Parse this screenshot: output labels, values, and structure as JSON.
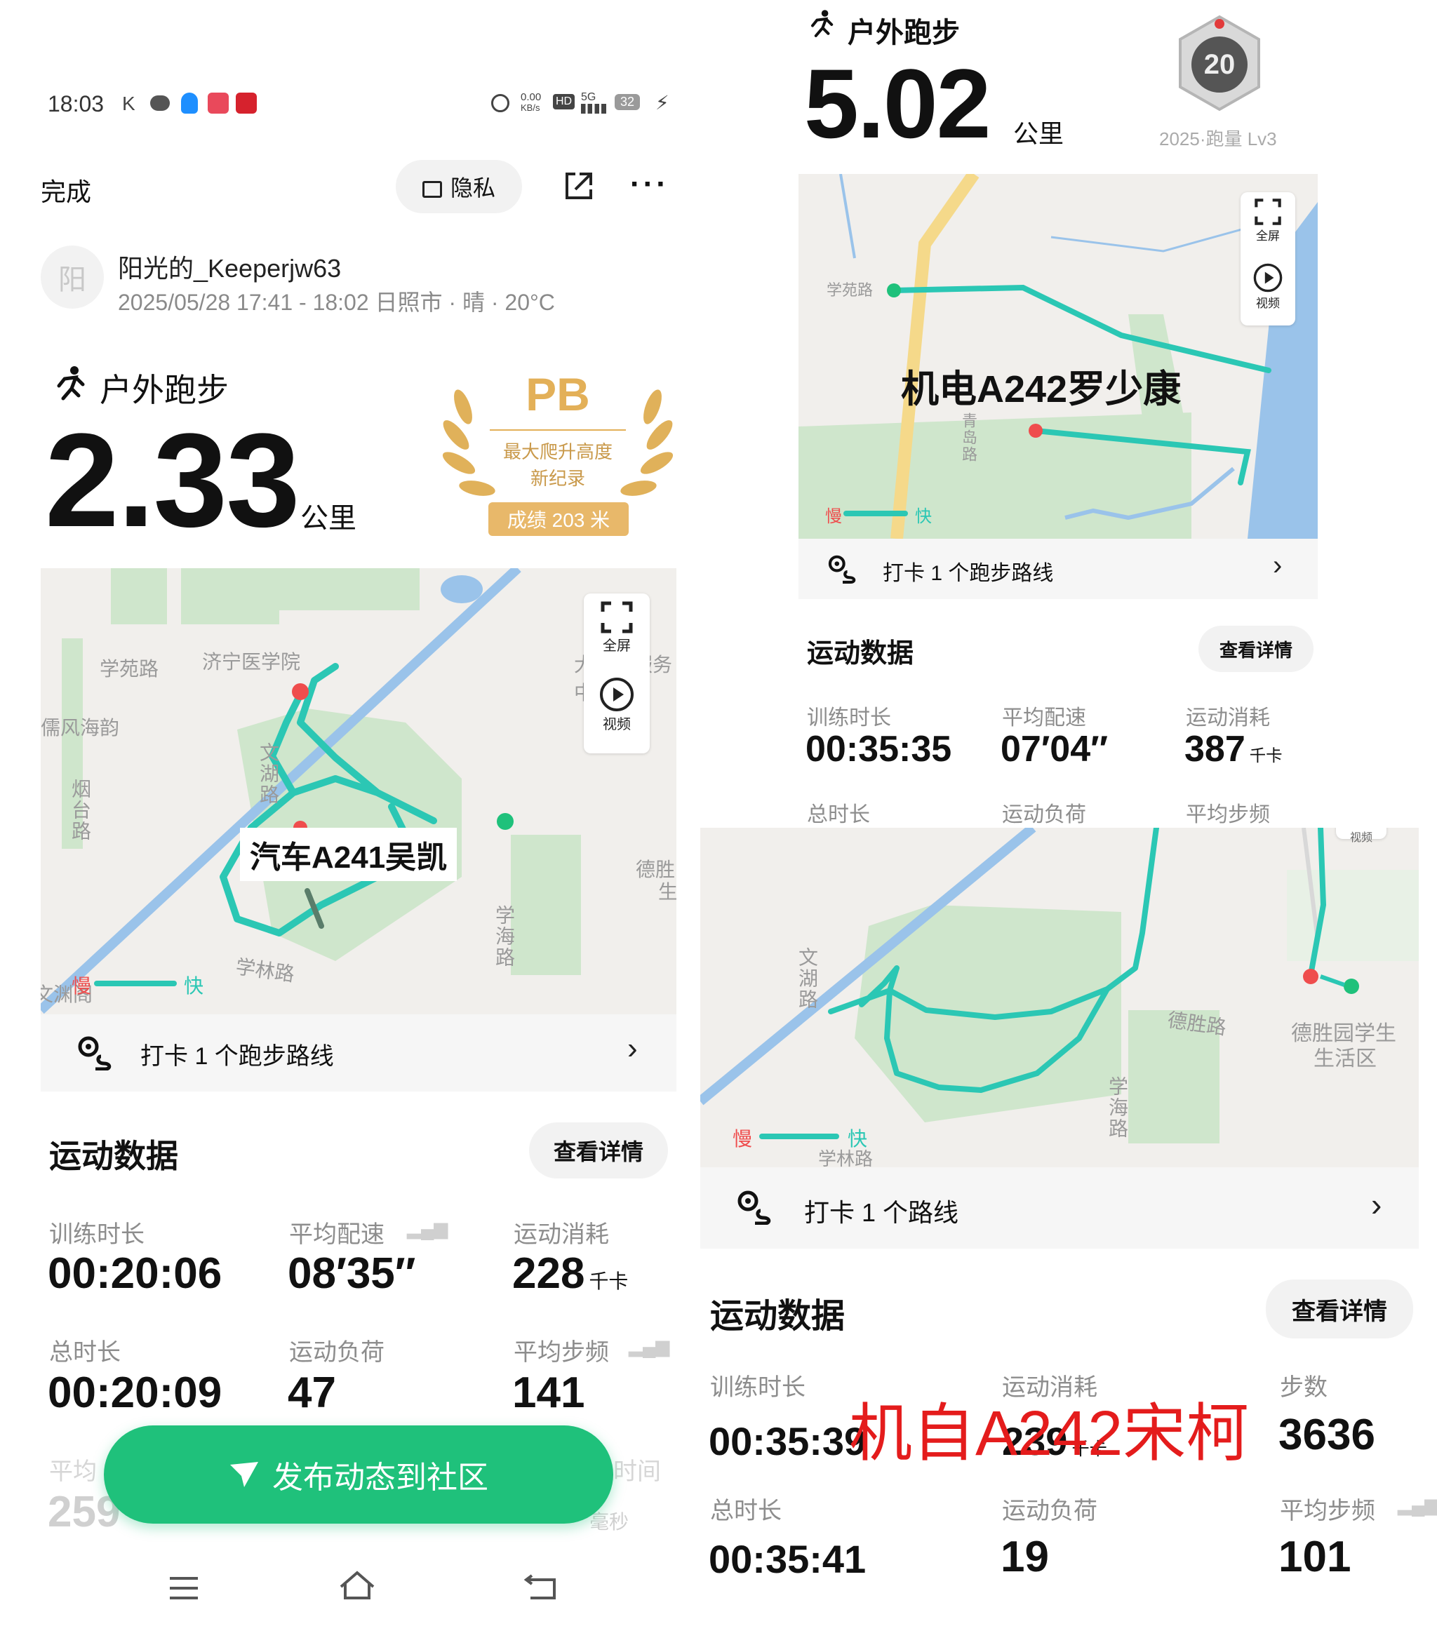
{
  "status_bar": {
    "time": "18:03",
    "speed": "0.00",
    "speed_unit": "KB/s",
    "hd": "HD",
    "net": "5G",
    "battery": "32"
  },
  "header": {
    "done": "完成",
    "privacy": "隐私"
  },
  "user": {
    "avatar_char": "阳",
    "name": "阳光的_Keeperjw63",
    "meta": "2025/05/28 17:41 - 18:02 日照市 · 晴 · 20°C"
  },
  "left_run": {
    "type": "户外跑步",
    "distance": "2.33",
    "unit": "公里",
    "pb": {
      "title": "PB",
      "line1": "最大爬升高度",
      "line2": "新纪录",
      "score": "成绩 203 米"
    },
    "map": {
      "labels": [
        "学苑路",
        "济宁医学院",
        "儒风海韵",
        "文湖路",
        "烟台路",
        "学林路",
        "学海路",
        "德胜",
        "生",
        "文渊阁",
        "大学生服务中心"
      ],
      "overlay": "汽车A241吴凯",
      "slow": "慢",
      "fast": "快",
      "fullscreen": "全屏",
      "video": "视频"
    },
    "checkin": "打卡 1 个跑步路线",
    "section_title": "运动数据",
    "details_btn": "查看详情",
    "stats": [
      {
        "label": "训练时长",
        "value": "00:20:06",
        "unit": ""
      },
      {
        "label": "平均配速",
        "value": "08′35″",
        "unit": ""
      },
      {
        "label": "运动消耗",
        "value": "228",
        "unit": "千卡"
      },
      {
        "label": "总时长",
        "value": "00:20:09",
        "unit": ""
      },
      {
        "label": "运动负荷",
        "value": "47",
        "unit": ""
      },
      {
        "label": "平均步频",
        "value": "141",
        "unit": ""
      }
    ],
    "partial": {
      "label1": "平均",
      "label3": "时间",
      "value1": "259",
      "unit3": "毫秒"
    },
    "publish_btn": "发布动态到社区"
  },
  "right_top": {
    "type": "户外跑步",
    "distance": "5.02",
    "unit": "公里",
    "badge_num": "20",
    "badge_caption": "2025·跑量 Lv3",
    "map": {
      "labels": [
        "学苑路",
        "青岛路"
      ],
      "overlay": "机电A242罗少康",
      "slow": "慢",
      "fast": "快",
      "fullscreen": "全屏",
      "video": "视频"
    },
    "checkin": "打卡 1 个跑步路线",
    "section_title": "运动数据",
    "details_btn": "查看详情",
    "stats": [
      {
        "label": "训练时长",
        "value": "00:35:35",
        "unit": ""
      },
      {
        "label": "平均配速",
        "value": "07′04″",
        "unit": ""
      },
      {
        "label": "运动消耗",
        "value": "387",
        "unit": "千卡"
      }
    ],
    "row2_labels": [
      "总时长",
      "运动负荷",
      "平均步频"
    ]
  },
  "right_bottom": {
    "map": {
      "labels": [
        "文湖路",
        "德胜路",
        "学海路",
        "德胜园学生",
        "生活区",
        "学林路"
      ],
      "slow": "慢",
      "fast": "快",
      "video": "视频"
    },
    "checkin": "打卡 1 个路线",
    "section_title": "运动数据",
    "details_btn": "查看详情",
    "stats": [
      {
        "label": "训练时长",
        "value": "00:35:39",
        "unit": ""
      },
      {
        "label": "运动消耗",
        "value": "239",
        "unit": "千卡"
      },
      {
        "label": "步数",
        "value": "3636",
        "unit": ""
      },
      {
        "label": "总时长",
        "value": "00:35:41",
        "unit": ""
      },
      {
        "label": "运动负荷",
        "value": "19",
        "unit": ""
      },
      {
        "label": "平均步频",
        "value": "101",
        "unit": ""
      }
    ],
    "overlay": "机自A242宋柯"
  },
  "colors": {
    "green": "#1fc17b",
    "route": "#2bc7b4",
    "map_green": "#cfe6cc",
    "water": "#9ac3ea",
    "road": "#f5d98a",
    "gold": "#d9a441",
    "red_overlay": "#e41c1c"
  }
}
